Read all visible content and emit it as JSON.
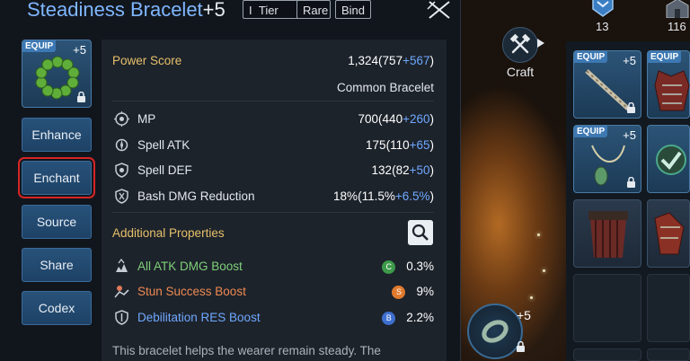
{
  "item": {
    "name": "Steadiness Bracelet",
    "enhance": "+5",
    "tags": [
      "Tier",
      "Rare",
      "Bind"
    ],
    "tier_prefix": "I",
    "equip_badge": "EQUIP",
    "slot_level": "+5"
  },
  "sidebar": {
    "buttons": [
      {
        "label": "Enhance",
        "selected": false
      },
      {
        "label": "Enchant",
        "selected": true
      },
      {
        "label": "Source",
        "selected": false
      },
      {
        "label": "Share",
        "selected": false
      },
      {
        "label": "Codex",
        "selected": false
      }
    ]
  },
  "info": {
    "power_label": "Power Score",
    "power_total": "1,324",
    "power_base": "757",
    "power_bonus": "+567",
    "item_type": "Common Bracelet",
    "stats": [
      {
        "icon": "mp-icon",
        "label": "MP",
        "total": "700",
        "base": "440",
        "bonus": "+260"
      },
      {
        "icon": "spell-atk-icon",
        "label": "Spell ATK",
        "total": "175",
        "base": "110",
        "bonus": "+65"
      },
      {
        "icon": "spell-def-icon",
        "label": "Spell DEF",
        "total": "132",
        "base": "82",
        "bonus": "+50"
      },
      {
        "icon": "bash-dmg-reduction-icon",
        "label": "Bash DMG Reduction",
        "total": "18%",
        "base": "11.5%",
        "bonus": "+6.5%"
      }
    ],
    "additional_label": "Additional Properties",
    "properties": [
      {
        "label": "All ATK DMG Boost",
        "grade": "C",
        "value": "0.3%",
        "label_color": "#7fd07a",
        "grade_color": "#3d9a4a"
      },
      {
        "label": "Stun Success Boost",
        "grade": "S",
        "value": "9%",
        "label_color": "#ef8a52",
        "grade_color": "#e07a2c"
      },
      {
        "label": "Debilitation RES Boost",
        "grade": "B",
        "value": "2.2%",
        "label_color": "#6ea8ff",
        "grade_color": "#3e6fcf"
      }
    ],
    "description": "This bracelet helps the wearer remain steady. The"
  },
  "hud": {
    "counter_1": "13",
    "counter_2": "116",
    "craft_label": "Craft"
  },
  "inventory": {
    "equip_badge": "EQUIP",
    "level": "+5",
    "ring_level": "+5"
  }
}
